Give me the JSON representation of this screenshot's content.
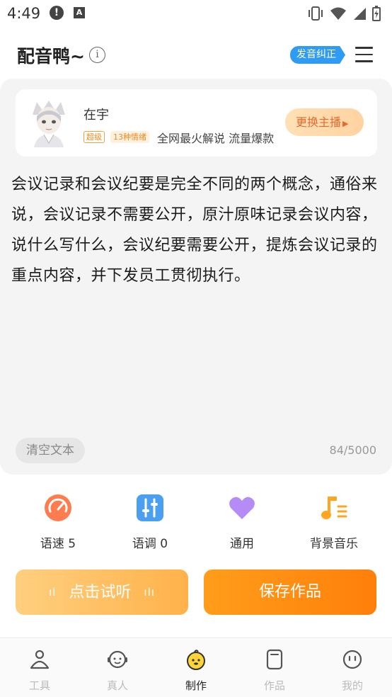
{
  "status_bar": {
    "time": "4:49"
  },
  "header": {
    "title": "配音鸭~",
    "pronunciation_badge": "发音纠正"
  },
  "speaker": {
    "name": "在宇",
    "tag_level": "超级",
    "tag_emotions": "13种情绪",
    "description": "全网最火解说 流量爆款",
    "change_label": "更换主播"
  },
  "editor": {
    "text": "会议记录和会议纪要是完全不同的两个概念，通俗来说，会议记录不需要公开，原汁原味记录会议内容，说什么写什么，会议纪要需要公开，提炼会议记录的重点内容，并下发员工贯彻执行。",
    "clear_label": "清空文本",
    "char_count": "84/5000"
  },
  "tools": [
    {
      "label": "语速 5",
      "icon": "speedometer-icon",
      "color": "#ff7c4f"
    },
    {
      "label": "语调 0",
      "icon": "slider-icon",
      "color": "#4a9ff0"
    },
    {
      "label": "通用",
      "icon": "heart-icon",
      "color": "#b58cf5"
    },
    {
      "label": "背景音乐",
      "icon": "music-note-icon",
      "color": "#ffa51f"
    }
  ],
  "actions": {
    "listen_label": "点击试听",
    "save_label": "保存作品"
  },
  "bottom_nav": [
    {
      "label": "工具",
      "icon": "tools-icon"
    },
    {
      "label": "真人",
      "icon": "person-face-icon"
    },
    {
      "label": "制作",
      "icon": "duck-icon",
      "active": true
    },
    {
      "label": "作品",
      "icon": "document-icon"
    },
    {
      "label": "我的",
      "icon": "profile-icon"
    }
  ],
  "colors": {
    "accent": "#ff8c10",
    "badge_blue": "#2f9bf1",
    "panel_bg": "#f4f4f4"
  }
}
